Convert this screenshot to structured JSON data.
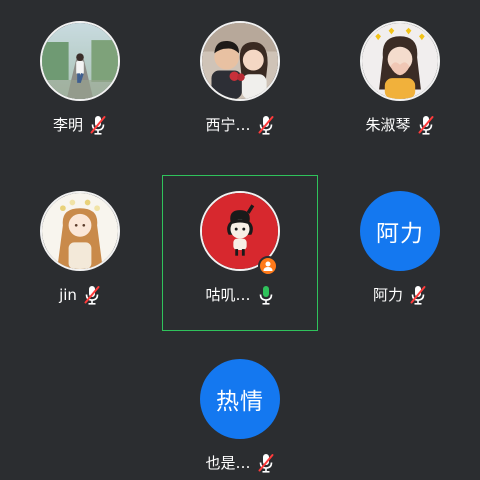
{
  "participants": [
    {
      "name": "李明",
      "avatar": "photo-person-running",
      "mic": "muted"
    },
    {
      "name": "西宁…",
      "avatar": "photo-couple",
      "mic": "muted"
    },
    {
      "name": "朱淑琴",
      "avatar": "photo-girl-hearts",
      "mic": "muted"
    },
    {
      "name": "jin",
      "avatar": "illustration-girl-flowers",
      "mic": "muted"
    },
    {
      "name": "咕叽…",
      "avatar": "cartoon-girl-red",
      "mic": "on",
      "is_host": true,
      "active_speaker": true
    },
    {
      "name": "阿力",
      "avatar_text": "阿力",
      "mic": "muted"
    },
    {
      "name": "也是…",
      "avatar_text": "热情",
      "mic": "muted"
    }
  ],
  "colors": {
    "background": "#2b2d30",
    "text_avatar": "#1478f0",
    "active_border": "#2fc25b",
    "muted_slash": "#ff3b3b",
    "mic_on": "#2fc25b",
    "host_badge": "#ff7a1a"
  }
}
